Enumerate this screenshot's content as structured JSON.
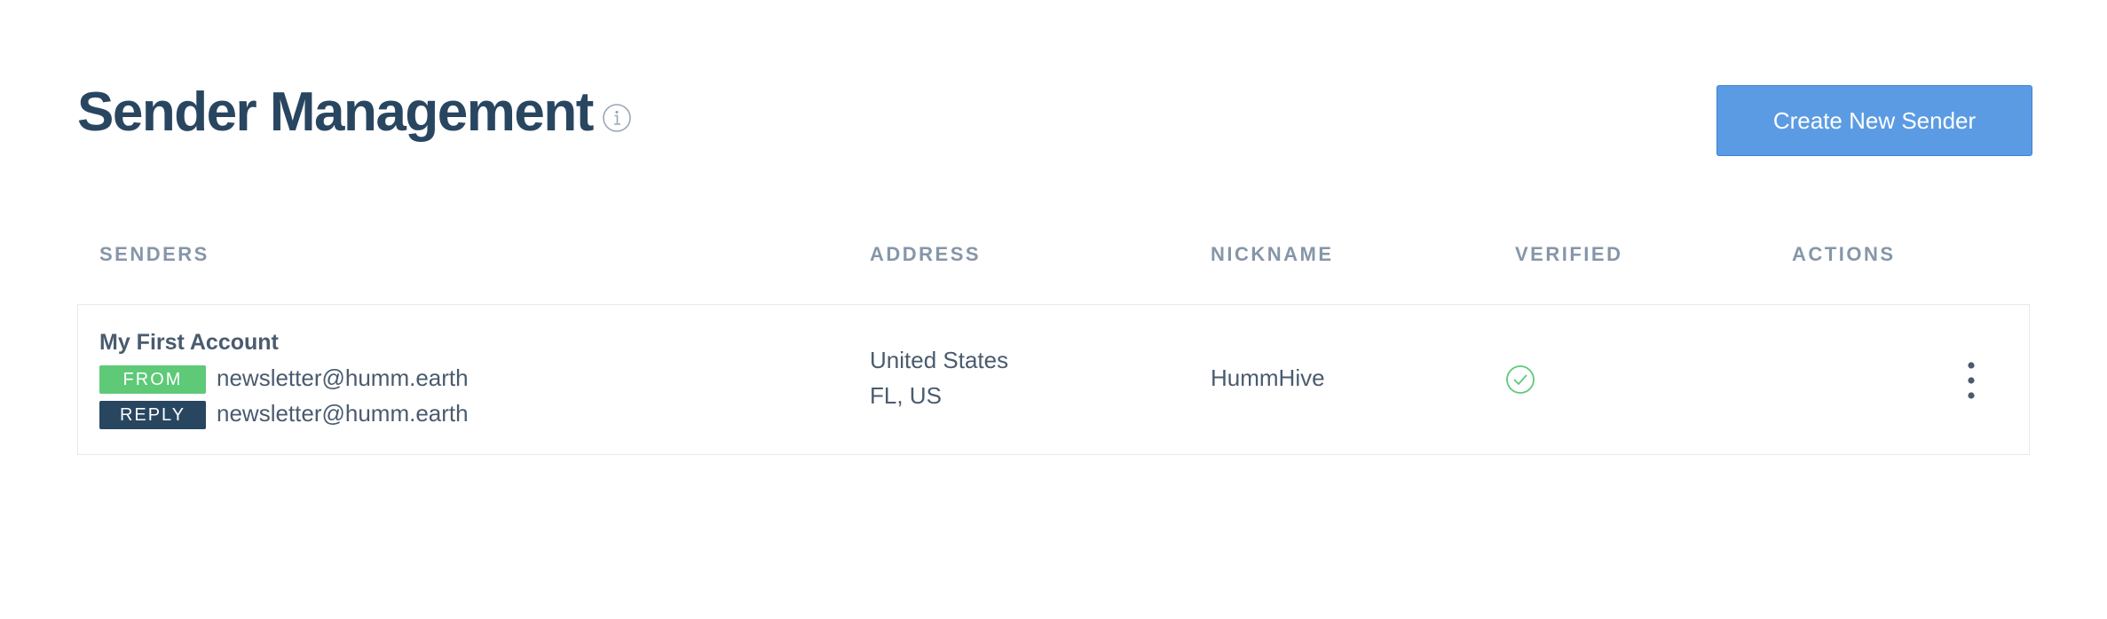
{
  "header": {
    "title": "Sender Management",
    "create_button_label": "Create New Sender"
  },
  "columns": {
    "senders": "SENDERS",
    "address": "ADDRESS",
    "nickname": "NICKNAME",
    "verified": "VERIFIED",
    "actions": "ACTIONS"
  },
  "rows": [
    {
      "account_name": "My First Account",
      "from_badge": "FROM",
      "from_email": "newsletter@humm.earth",
      "reply_badge": "REPLY",
      "reply_email": "newsletter@humm.earth",
      "address_line1": "United States",
      "address_line2": "FL, US",
      "nickname": "HummHive",
      "verified": true
    }
  ],
  "colors": {
    "title": "#294661",
    "button": "#5b9be3",
    "from_badge": "#5ec977",
    "reply_badge": "#294661",
    "verified": "#5ec977"
  },
  "icons": {
    "info": "info-icon",
    "verified": "check-circle-icon",
    "actions": "more-vertical-icon"
  }
}
